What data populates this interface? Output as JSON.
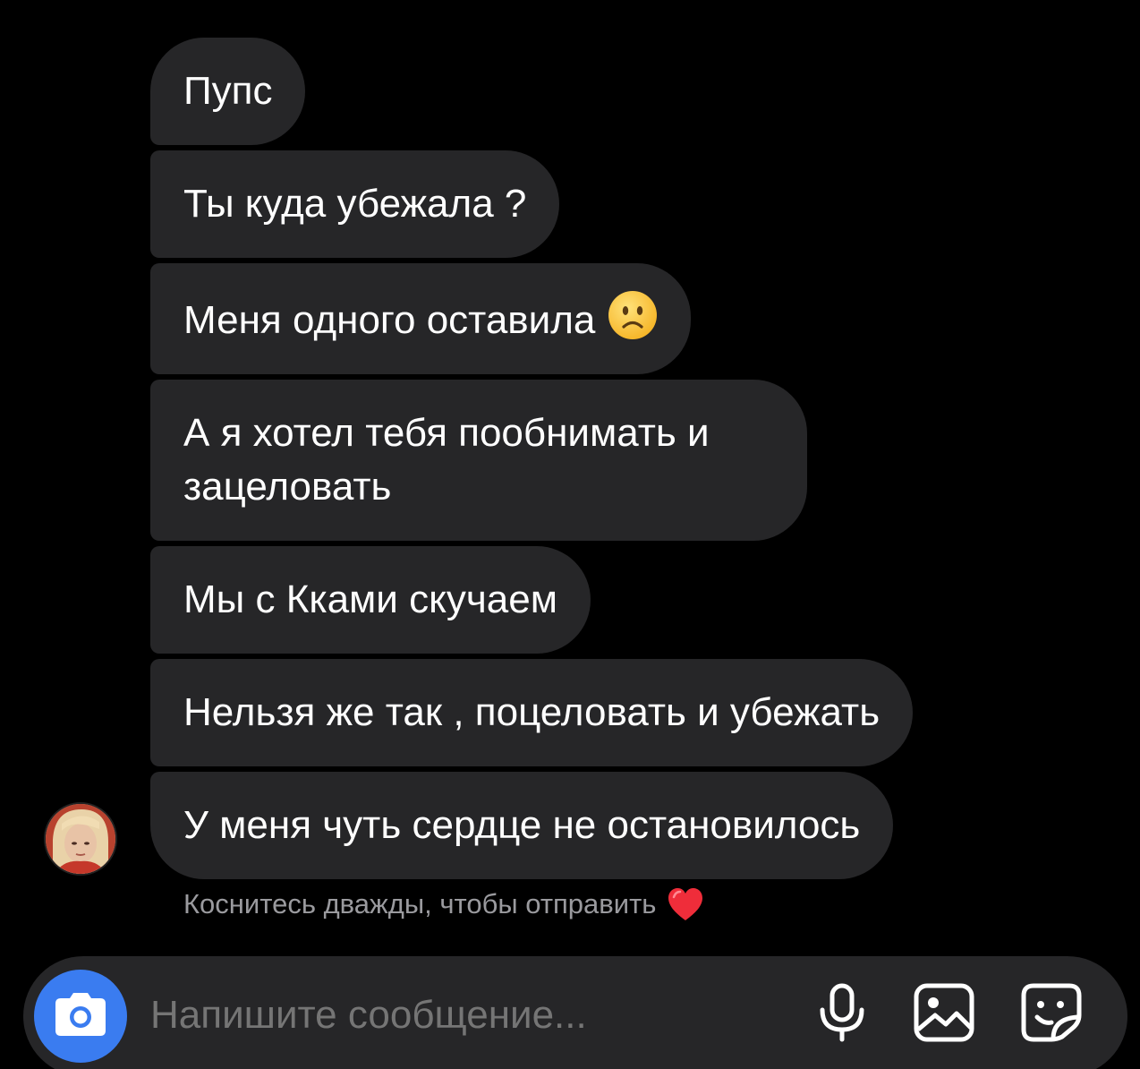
{
  "messages": [
    {
      "text": "Пупс"
    },
    {
      "text": "Ты куда убежала ?"
    },
    {
      "text": "Меня одного оставила",
      "emoji": "sad-face-emoji"
    },
    {
      "text": "А я хотел тебя пообнимать и зацеловать"
    },
    {
      "text": "Мы с Кками скучаем"
    },
    {
      "text": "Нельзя же так , поцеловать и убежать"
    },
    {
      "text": "У меня чуть сердце не остановилось"
    }
  ],
  "hint": {
    "text": "Коснитесь дважды, чтобы отправить",
    "icon": "red-heart-icon"
  },
  "composer": {
    "placeholder": "Напишите сообщение...",
    "icons": [
      "camera-icon",
      "microphone-icon",
      "gallery-icon",
      "sticker-icon"
    ],
    "camera_color": "#3a7cf0"
  },
  "colors": {
    "background": "#000000",
    "bubble": "#262628",
    "hint_text": "#9a9a9e"
  }
}
